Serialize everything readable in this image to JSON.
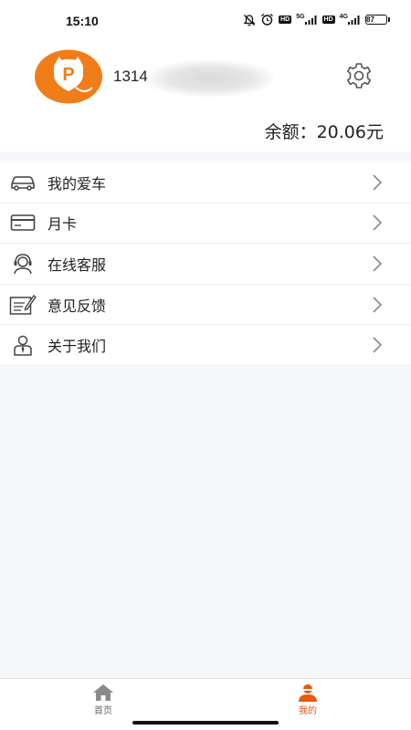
{
  "status_bar": {
    "time": "15:10",
    "network_5g": "5G",
    "network_4g": "4G",
    "hd_label": "HD",
    "battery": "87"
  },
  "profile": {
    "phone_prefix": "1314",
    "balance_label": "余额：",
    "balance_value": "20.06元",
    "avatar_letter": "P"
  },
  "menu": {
    "items": [
      {
        "label": "我的爱车",
        "icon": "car-icon"
      },
      {
        "label": "月卡",
        "icon": "card-icon"
      },
      {
        "label": "在线客服",
        "icon": "headset-icon"
      },
      {
        "label": "意见反馈",
        "icon": "feedback-icon"
      },
      {
        "label": "关于我们",
        "icon": "person-icon"
      }
    ]
  },
  "tabbar": {
    "home_label": "首页",
    "mine_label": "我的"
  },
  "colors": {
    "accent": "#e8590c",
    "avatar_orange": "#f07d1a"
  }
}
